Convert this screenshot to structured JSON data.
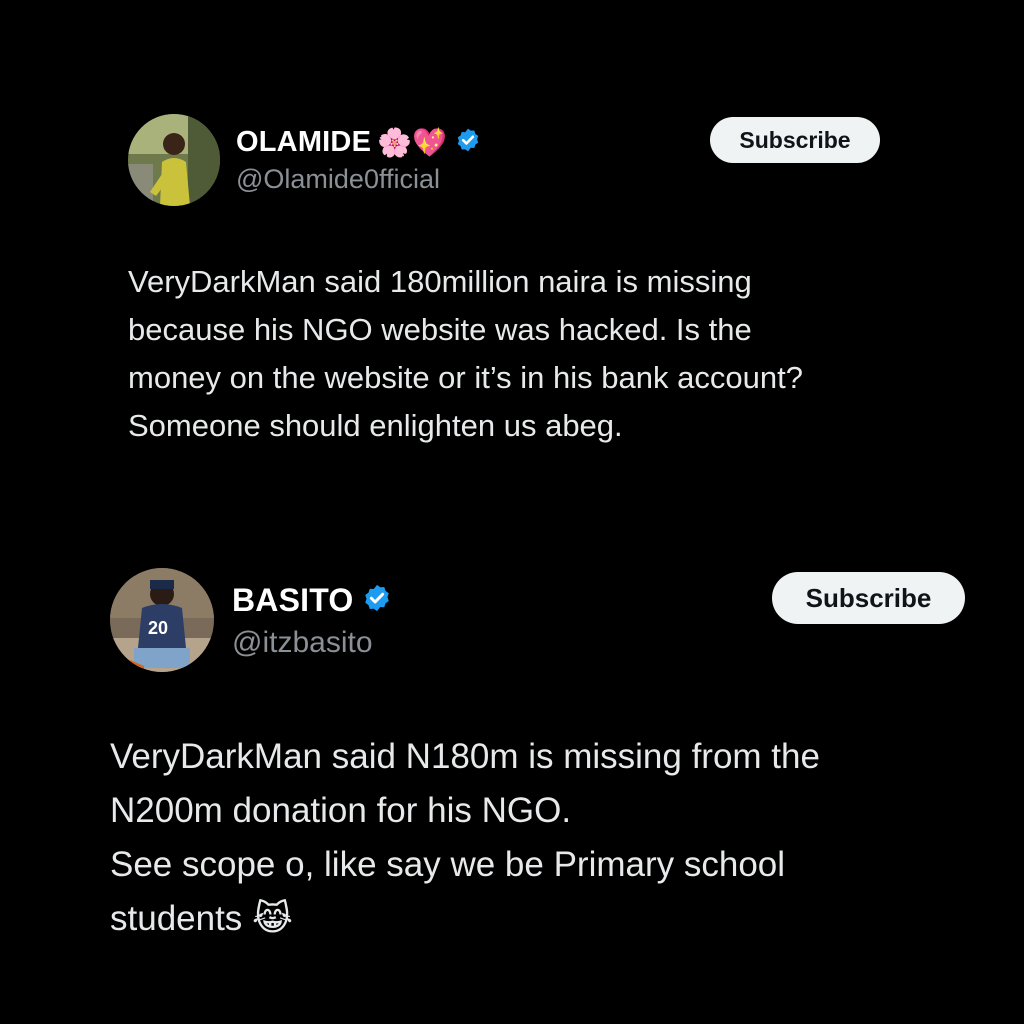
{
  "tweets": [
    {
      "display_name": "OLAMIDE",
      "name_emoji": "🌸💖",
      "handle": "@Olamide0fficial",
      "subscribe_label": "Subscribe",
      "text": "VeryDarkMan said 180million naira is missing\nbecause his NGO website was hacked. Is the\nmoney on the website or it’s in his bank account?\nSomeone should enlighten us abeg.",
      "verified_icon": "verified-badge-icon",
      "verified_color": "#1d9bf0"
    },
    {
      "display_name": "BASITO",
      "handle": "@itzbasito",
      "subscribe_label": "Subscribe",
      "text": "VeryDarkMan said N180m is missing from the\nN200m donation for his NGO.\nSee scope o, like say we be Primary school\nstudents 😹",
      "verified_icon": "verified-badge-icon",
      "verified_color": "#1d9bf0"
    }
  ]
}
